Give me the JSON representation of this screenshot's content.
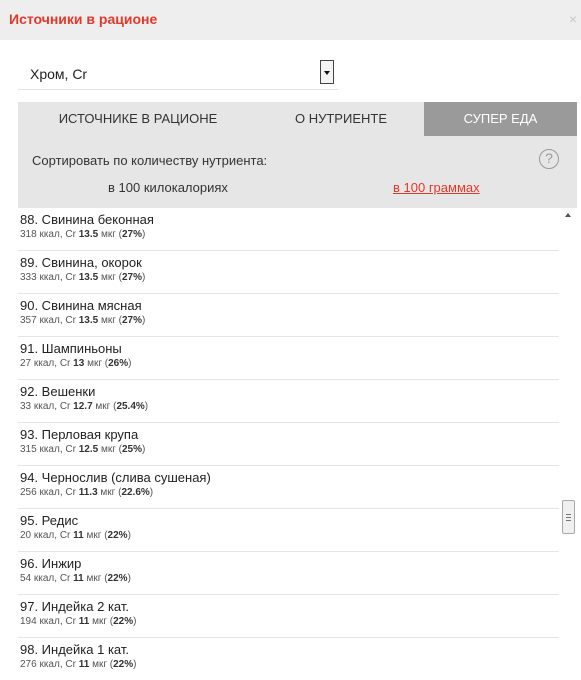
{
  "header": {
    "title": "Источники в рационе",
    "close_icon": "close-icon"
  },
  "nutrient_select": {
    "value": "Хром, Cr"
  },
  "tabs": [
    {
      "label": "ИСТОЧНИКЕ В РАЦИОНЕ",
      "active": false
    },
    {
      "label": "О НУТРИЕНТЕ",
      "active": false
    },
    {
      "label": "СУПЕР ЕДА",
      "active": true
    }
  ],
  "sort": {
    "label": "Сортировать по количеству нутриента:",
    "option_kcal": "в 100 килокалориях",
    "option_grams": "в 100 граммах",
    "help_icon": "?"
  },
  "colors": {
    "accent": "#e0392b",
    "active_tab": "#9a9a9a",
    "panel": "#e6e6e6"
  },
  "items": [
    {
      "name": "88. Свинина беконная",
      "kcal": "318 ккал, Cr",
      "amount": "13.5",
      "unit": "мкг",
      "percent": "27%"
    },
    {
      "name": "89. Свинина, окорок",
      "kcal": "333 ккал, Cr",
      "amount": "13.5",
      "unit": "мкг",
      "percent": "27%"
    },
    {
      "name": "90. Свинина мясная",
      "kcal": "357 ккал, Cr",
      "amount": "13.5",
      "unit": "мкг",
      "percent": "27%"
    },
    {
      "name": "91. Шампиньоны",
      "kcal": "27 ккал, Cr",
      "amount": "13",
      "unit": "мкг",
      "percent": "26%"
    },
    {
      "name": "92. Вешенки",
      "kcal": "33 ккал, Cr",
      "amount": "12.7",
      "unit": "мкг",
      "percent": "25.4%"
    },
    {
      "name": "93. Перловая крупа",
      "kcal": "315 ккал, Cr",
      "amount": "12.5",
      "unit": "мкг",
      "percent": "25%"
    },
    {
      "name": "94. Чернослив (слива сушеная)",
      "kcal": "256 ккал, Cr",
      "amount": "11.3",
      "unit": "мкг",
      "percent": "22.6%"
    },
    {
      "name": "95. Редис",
      "kcal": "20 ккал, Cr",
      "amount": "11",
      "unit": "мкг",
      "percent": "22%"
    },
    {
      "name": "96. Инжир",
      "kcal": "54 ккал, Cr",
      "amount": "11",
      "unit": "мкг",
      "percent": "22%"
    },
    {
      "name": "97. Индейка 2 кат.",
      "kcal": "194 ккал, Cr",
      "amount": "11",
      "unit": "мкг",
      "percent": "22%"
    },
    {
      "name": "98. Индейка 1 кат.",
      "kcal": "276 ккал, Cr",
      "amount": "11",
      "unit": "мкг",
      "percent": "22%"
    }
  ]
}
